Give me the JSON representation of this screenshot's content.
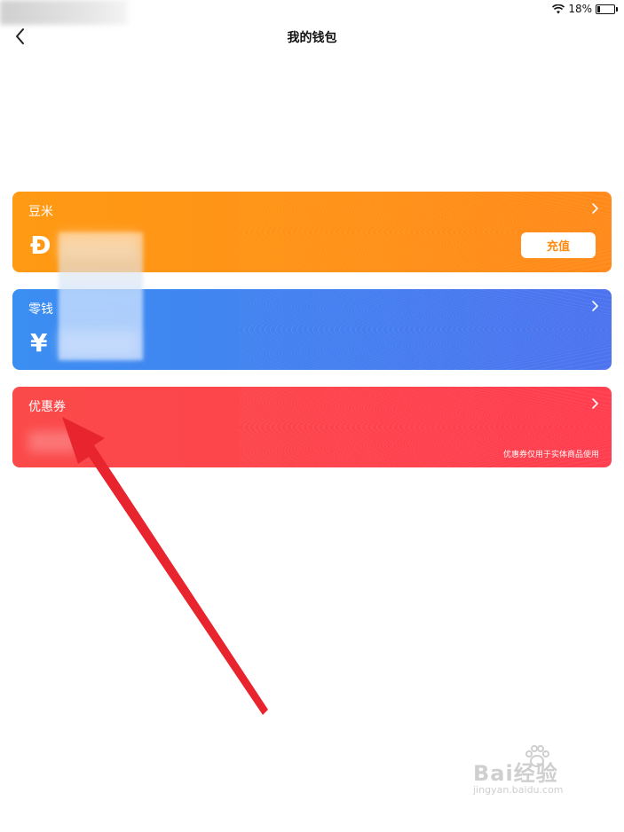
{
  "status_bar": {
    "battery": "18%"
  },
  "header": {
    "title": "我的钱包"
  },
  "cards": {
    "bean": {
      "title": "豆米",
      "symbol": "Ɖ",
      "recharge_label": "充值"
    },
    "change": {
      "title": "零钱",
      "symbol": "¥"
    },
    "coupon": {
      "title": "优惠券",
      "note": "优惠券仅用于实体商品使用"
    }
  },
  "watermark": {
    "brand": "Bai经验",
    "sub": "jingyan.baidu.com"
  },
  "colors": {
    "bean_card": "#ff9214",
    "change_card": "#3f86f0",
    "coupon_card": "#fb4a4a",
    "arrow": "#e8242f"
  }
}
